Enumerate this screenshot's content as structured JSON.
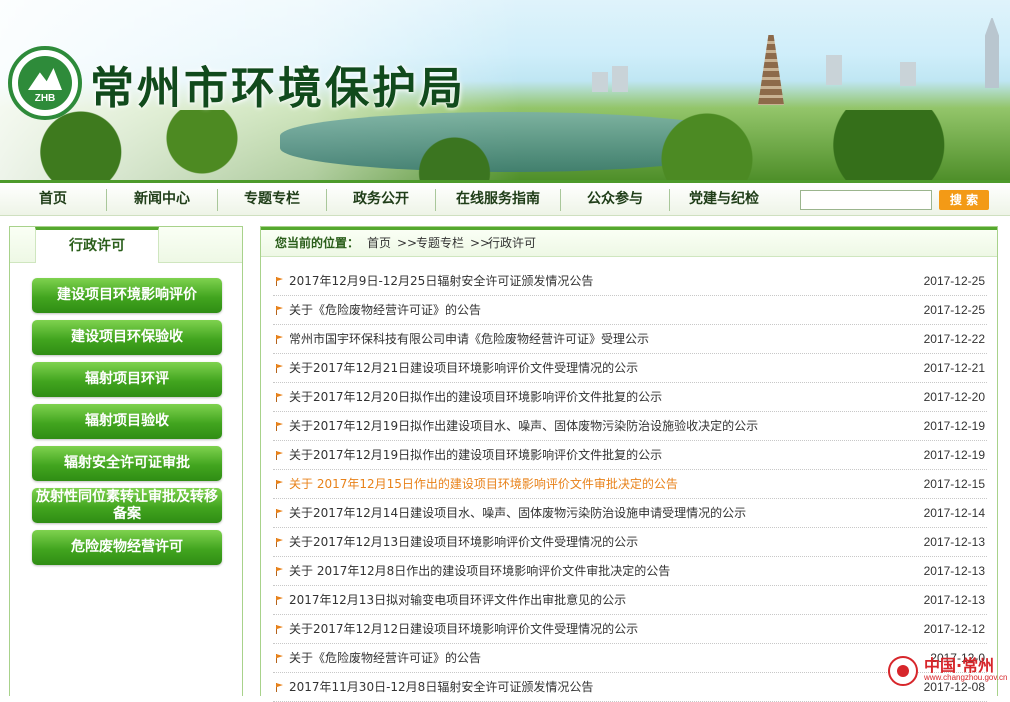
{
  "site": {
    "title": "常州市环境保护局",
    "logo_text": "ZHB"
  },
  "nav": {
    "items": [
      "首页",
      "新闻中心",
      "专题专栏",
      "政务公开",
      "在线服务指南",
      "公众参与",
      "党建与纪检"
    ],
    "search_button": "搜 索"
  },
  "sidebar": {
    "heading": "行政许可",
    "buttons": [
      "建设项目环境影响评价",
      "建设项目环保验收",
      "辐射项目环评",
      "辐射项目验收",
      "辐射安全许可证审批",
      "放射性同位素转让审批及转移备案",
      "危险废物经营许可"
    ]
  },
  "breadcrumb": {
    "label": "您当前的位置：",
    "path": [
      "首页",
      "专题专栏",
      "行政许可"
    ],
    "sep": ">>"
  },
  "list": [
    {
      "title": "2017年12月9日-12月25日辐射安全许可证颁发情况公告",
      "date": "2017-12-25"
    },
    {
      "title": "关于《危险废物经营许可证》的公告",
      "date": "2017-12-25"
    },
    {
      "title": "常州市国宇环保科技有限公司申请《危险废物经营许可证》受理公示",
      "date": "2017-12-22"
    },
    {
      "title": "关于2017年12月21日建设项目环境影响评价文件受理情况的公示",
      "date": "2017-12-21"
    },
    {
      "title": "关于2017年12月20日拟作出的建设项目环境影响评价文件批复的公示",
      "date": "2017-12-20"
    },
    {
      "title": "关于2017年12月19日拟作出建设项目水、噪声、固体废物污染防治设施验收决定的公示",
      "date": "2017-12-19"
    },
    {
      "title": "关于2017年12月19日拟作出的建设项目环境影响评价文件批复的公示",
      "date": "2017-12-19"
    },
    {
      "title": "关于 2017年12月15日作出的建设项目环境影响评价文件审批决定的公告",
      "date": "2017-12-15",
      "highlight": true
    },
    {
      "title": "关于2017年12月14日建设项目水、噪声、固体废物污染防治设施申请受理情况的公示",
      "date": "2017-12-14"
    },
    {
      "title": "关于2017年12月13日建设项目环境影响评价文件受理情况的公示",
      "date": "2017-12-13"
    },
    {
      "title": "关于 2017年12月8日作出的建设项目环境影响评价文件审批决定的公告",
      "date": "2017-12-13"
    },
    {
      "title": "2017年12月13日拟对输变电项目环评文件作出审批意见的公示",
      "date": "2017-12-13"
    },
    {
      "title": "关于2017年12月12日建设项目环境影响评价文件受理情况的公示",
      "date": "2017-12-12"
    },
    {
      "title": "关于《危险废物经营许可证》的公告",
      "date": "2017-12-0"
    },
    {
      "title": "2017年11月30日-12月8日辐射安全许可证颁发情况公告",
      "date": "2017-12-08"
    }
  ],
  "watermark": {
    "name": "中国·常州",
    "url": "www.changzhou.gov.cn"
  }
}
